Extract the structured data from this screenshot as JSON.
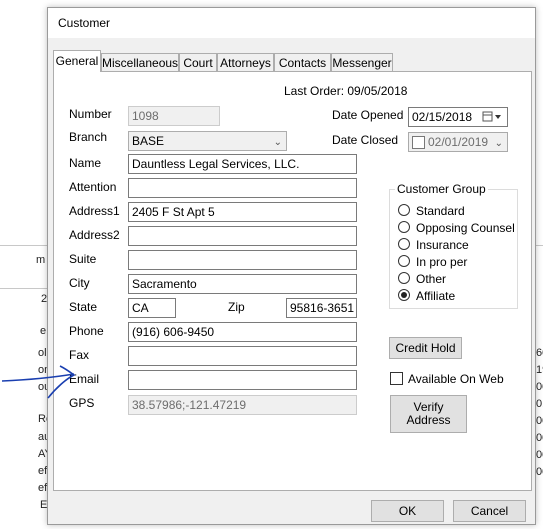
{
  "background": {
    "left_fragments": [
      "m",
      "2",
      "e",
      "oll",
      "on",
      "ou",
      "Re",
      "au",
      "AY",
      "ef",
      "ef",
      "E"
    ],
    "right_fragments": [
      "60",
      "19",
      "00",
      "01",
      "00",
      "00",
      "00",
      "00"
    ]
  },
  "dialog": {
    "title": "Customer",
    "tabs": [
      "General",
      "Miscellaneous",
      "Court",
      "Attorneys",
      "Contacts",
      "Messenger"
    ],
    "active_tab": "General"
  },
  "general": {
    "last_order": "Last Order: 09/05/2018",
    "number_label": "Number",
    "number_value": "1098",
    "branch_label": "Branch",
    "branch_value": "BASE",
    "name_label": "Name",
    "name_value": "Dauntless Legal Services, LLC.",
    "attention_label": "Attention",
    "attention_value": "",
    "address1_label": "Address1",
    "address1_value": "2405 F St Apt 5",
    "address2_label": "Address2",
    "address2_value": "",
    "suite_label": "Suite",
    "suite_value": "",
    "city_label": "City",
    "city_value": "Sacramento",
    "state_label": "State",
    "state_value": "CA",
    "zip_label": "Zip",
    "zip_value": "95816-3651",
    "phone_label": "Phone",
    "phone_value": "(916) 606-9450",
    "fax_label": "Fax",
    "fax_value": "",
    "email_label": "Email",
    "email_value": "",
    "gps_label": "GPS",
    "gps_value": "38.57986;-121.47219",
    "date_opened_label": "Date Opened",
    "date_opened_value": "02/15/2018",
    "date_closed_label": "Date Closed",
    "date_closed_value": "02/01/2019",
    "customer_group_label": "Customer Group",
    "customer_group_options": [
      "Standard",
      "Opposing Counsel",
      "Insurance",
      "In pro per",
      "Other",
      "Affiliate"
    ],
    "customer_group_selected": "Affiliate",
    "credit_hold_label": "Credit Hold",
    "available_on_web_label": "Available On Web",
    "verify_address_line1": "Verify",
    "verify_address_line2": "Address"
  },
  "footer": {
    "ok_label": "OK",
    "cancel_label": "Cancel"
  },
  "colors": {
    "annotation_arrow": "#1a3fb0",
    "dialog_bg": "#f0f0f0"
  }
}
